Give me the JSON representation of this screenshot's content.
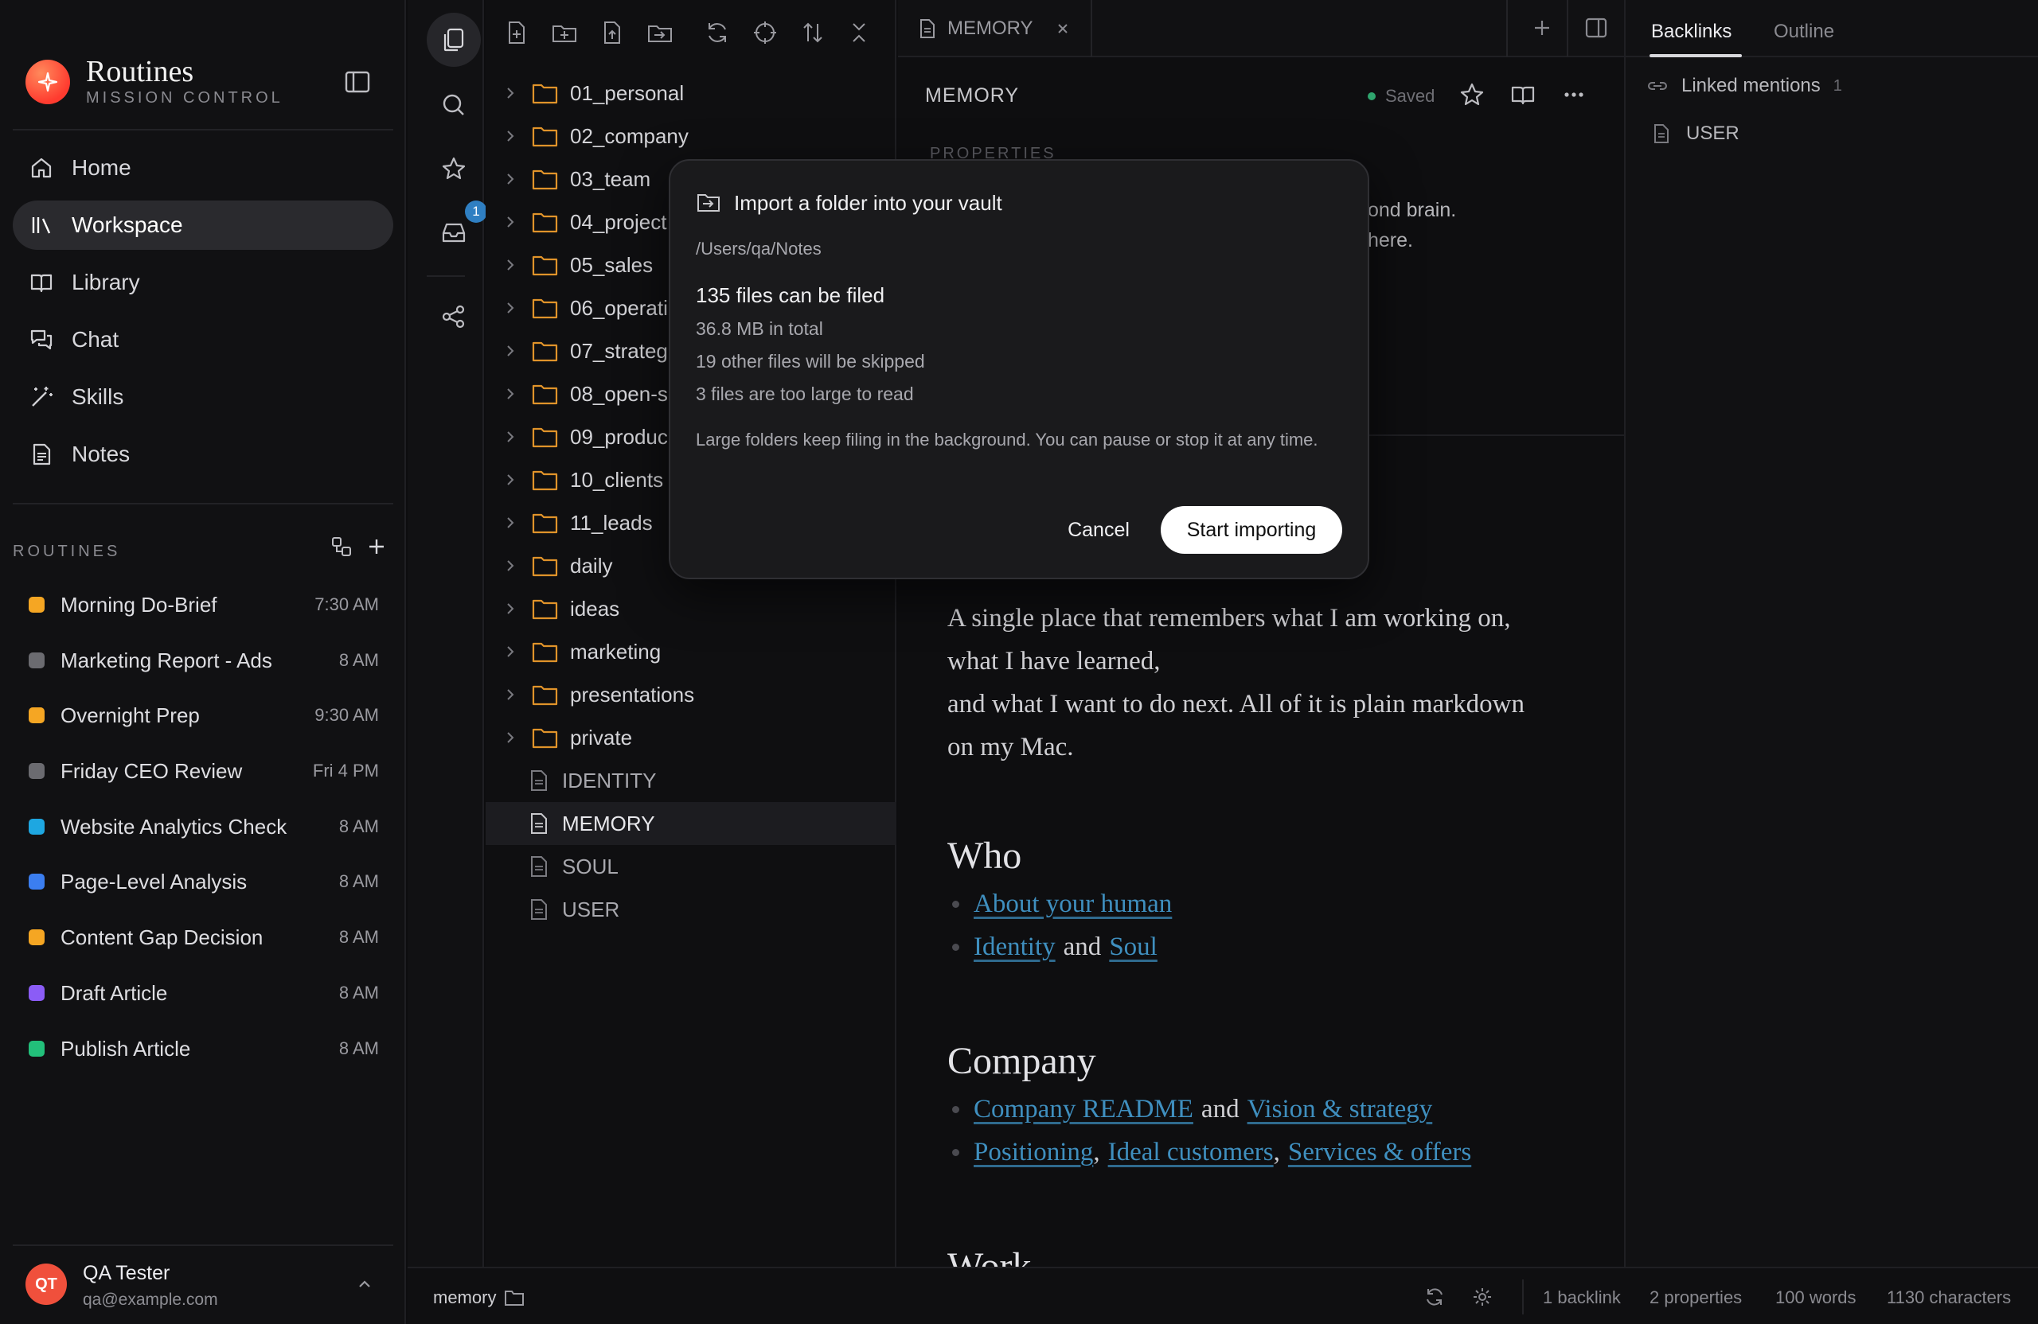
{
  "app": {
    "title": "Routines",
    "subtitle": "MISSION CONTROL"
  },
  "nav": [
    {
      "label": "Home",
      "icon": "home-icon"
    },
    {
      "label": "Workspace",
      "icon": "library-icon",
      "active": true
    },
    {
      "label": "Library",
      "icon": "book-icon"
    },
    {
      "label": "Chat",
      "icon": "chat-icon"
    },
    {
      "label": "Skills",
      "icon": "wand-icon"
    },
    {
      "label": "Notes",
      "icon": "note-icon"
    }
  ],
  "routines_section": {
    "label": "ROUTINES"
  },
  "routines": [
    {
      "name": "Morning Do-Brief",
      "time": "7:30 AM",
      "color": "#f5a623"
    },
    {
      "name": "Marketing Report - Ads",
      "time": "8 AM",
      "color": "#6b6b70"
    },
    {
      "name": "Overnight Prep",
      "time": "9:30 AM",
      "color": "#f5a623"
    },
    {
      "name": "Friday CEO Review",
      "time": "Fri 4 PM",
      "color": "#6b6b70"
    },
    {
      "name": "Website Analytics Check",
      "time": "8 AM",
      "color": "#1ea7e1"
    },
    {
      "name": "Page-Level Analysis",
      "time": "8 AM",
      "color": "#3b7ef0"
    },
    {
      "name": "Content Gap Decision",
      "time": "8 AM",
      "color": "#f5a623"
    },
    {
      "name": "Draft Article",
      "time": "8 AM",
      "color": "#8b5cf6"
    },
    {
      "name": "Publish Article",
      "time": "8 AM",
      "color": "#22c07a"
    }
  ],
  "user": {
    "initials": "QT",
    "name": "QA Tester",
    "email": "qa@example.com"
  },
  "rail": {
    "inbox_badge": "1"
  },
  "tree": {
    "folders": [
      "01_personal",
      "02_company",
      "03_team",
      "04_project",
      "05_sales",
      "06_operati",
      "07_strateg",
      "08_open-s",
      "09_produc",
      "10_clients",
      "11_leads",
      "daily",
      "ideas",
      "marketing",
      "presentations",
      "private"
    ],
    "files": [
      {
        "name": "IDENTITY"
      },
      {
        "name": "MEMORY",
        "selected": true
      },
      {
        "name": "SOUL"
      },
      {
        "name": "USER"
      }
    ]
  },
  "tab": {
    "label": "MEMORY"
  },
  "editor": {
    "title": "MEMORY",
    "saved": "Saved",
    "props_label": "PROPERTIES",
    "peek1": "ond brain.",
    "peek2": "here.",
    "intro1": "A single place that remembers what I am working on,",
    "intro2": "what I have learned,",
    "intro3": "and what I want to do next. All of it is plain markdown",
    "intro4": "on my Mac.",
    "h_who": "Who",
    "who_link1": "About your human",
    "who_link2": "Identity",
    "who_and": "and",
    "who_link3": "Soul",
    "h_company": "Company",
    "co_link1": "Company README",
    "co_and": "and",
    "co_link2": "Vision & strategy",
    "co_link3": "Positioning",
    "co_link4": "Ideal customers",
    "co_link5": "Services & offers",
    "comma": ",",
    "h_work": "Work"
  },
  "rpanel": {
    "tab_backlinks": "Backlinks",
    "tab_outline": "Outline",
    "linked_label": "Linked mentions",
    "linked_count": "1",
    "linked_item": "USER"
  },
  "status": {
    "folder": "memory",
    "backlinks": "1 backlink",
    "properties": "2 properties",
    "words": "100 words",
    "characters": "1130 characters"
  },
  "modal": {
    "title": "Import a folder into your vault",
    "path": "/Users/qa/Notes",
    "count": "135 files can be filed",
    "size": "36.8 MB in total",
    "skipped": "19 other files will be skipped",
    "too_large": "3 files are too large to read",
    "note": "Large folders keep filing in the background. You can pause or stop it at any time.",
    "cancel": "Cancel",
    "start": "Start importing"
  }
}
